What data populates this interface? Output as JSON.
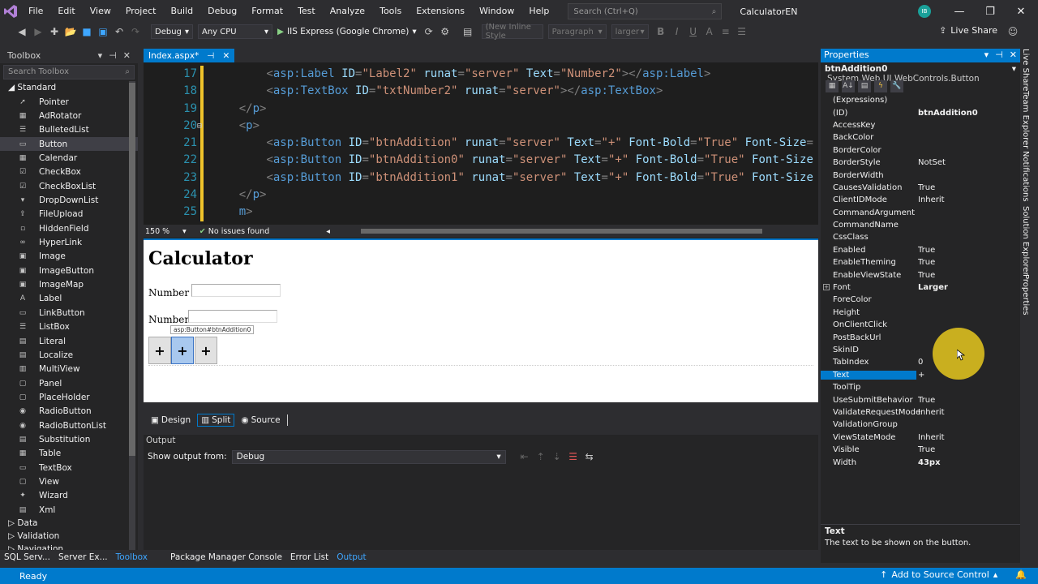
{
  "menu": [
    "File",
    "Edit",
    "View",
    "Project",
    "Build",
    "Debug",
    "Format",
    "Test",
    "Analyze",
    "Tools",
    "Extensions",
    "Window",
    "Help"
  ],
  "search": {
    "placeholder": "Search (Ctrl+Q)"
  },
  "solution_name": "CalculatorEN",
  "user_initials": "IB",
  "toolbar": {
    "config": "Debug",
    "platform": "Any CPU",
    "run_target": "IIS Express (Google Chrome)",
    "style_combo": "(New Inline Style",
    "block_combo": "Paragraph",
    "size_combo": "larger",
    "live_share": "Live Share"
  },
  "toolbox": {
    "title": "Toolbox",
    "search_placeholder": "Search Toolbox",
    "group_standard": "Standard",
    "items": [
      "Pointer",
      "AdRotator",
      "BulletedList",
      "Button",
      "Calendar",
      "CheckBox",
      "CheckBoxList",
      "DropDownList",
      "FileUpload",
      "HiddenField",
      "HyperLink",
      "Image",
      "ImageButton",
      "ImageMap",
      "Label",
      "LinkButton",
      "ListBox",
      "Literal",
      "Localize",
      "MultiView",
      "Panel",
      "PlaceHolder",
      "RadioButton",
      "RadioButtonList",
      "Substitution",
      "Table",
      "TextBox",
      "View",
      "Wizard",
      "Xml"
    ],
    "selected_item": "Button",
    "groups_collapsed": [
      "Data",
      "Validation",
      "Navigation"
    ]
  },
  "editor": {
    "tab_name": "Index.aspx*",
    "zoom": "150 %",
    "issues": "No issues found",
    "code_lines": [
      {
        "num": "17",
        "fold": "",
        "indent": "        ",
        "parts": [
          [
            "b",
            "<"
          ],
          [
            "t",
            "asp:Label"
          ],
          [
            "p",
            " "
          ],
          [
            "a",
            "ID"
          ],
          [
            "b",
            "="
          ],
          [
            "v",
            "\"Label2\""
          ],
          [
            "p",
            " "
          ],
          [
            "a",
            "runat"
          ],
          [
            "b",
            "="
          ],
          [
            "v",
            "\"server\""
          ],
          [
            "p",
            " "
          ],
          [
            "a",
            "Text"
          ],
          [
            "b",
            "="
          ],
          [
            "v",
            "\"Number2\""
          ],
          [
            "b",
            "></"
          ],
          [
            "t",
            "asp:Label"
          ],
          [
            "b",
            ">"
          ]
        ]
      },
      {
        "num": "18",
        "fold": "",
        "indent": "        ",
        "parts": [
          [
            "b",
            "<"
          ],
          [
            "t",
            "asp:TextBox"
          ],
          [
            "p",
            " "
          ],
          [
            "a",
            "ID"
          ],
          [
            "b",
            "="
          ],
          [
            "v",
            "\"txtNumber2\""
          ],
          [
            "p",
            " "
          ],
          [
            "a",
            "runat"
          ],
          [
            "b",
            "="
          ],
          [
            "v",
            "\"server\""
          ],
          [
            "b",
            "></"
          ],
          [
            "t",
            "asp:TextBox"
          ],
          [
            "b",
            ">"
          ]
        ]
      },
      {
        "num": "19",
        "fold": "",
        "indent": "    ",
        "parts": [
          [
            "b",
            "</"
          ],
          [
            "t",
            "p"
          ],
          [
            "b",
            ">"
          ]
        ]
      },
      {
        "num": "20",
        "fold": "⊟",
        "indent": "    ",
        "parts": [
          [
            "b",
            "<"
          ],
          [
            "t",
            "p"
          ],
          [
            "b",
            ">"
          ]
        ]
      },
      {
        "num": "21",
        "fold": "",
        "indent": "        ",
        "parts": [
          [
            "b",
            "<"
          ],
          [
            "t",
            "asp:Button"
          ],
          [
            "p",
            " "
          ],
          [
            "a",
            "ID"
          ],
          [
            "b",
            "="
          ],
          [
            "v",
            "\"btnAddition\""
          ],
          [
            "p",
            " "
          ],
          [
            "a",
            "runat"
          ],
          [
            "b",
            "="
          ],
          [
            "v",
            "\"server\""
          ],
          [
            "p",
            " "
          ],
          [
            "a",
            "Text"
          ],
          [
            "b",
            "="
          ],
          [
            "v",
            "\"+\""
          ],
          [
            "p",
            " "
          ],
          [
            "a",
            "Font-Bold"
          ],
          [
            "b",
            "="
          ],
          [
            "v",
            "\"True\""
          ],
          [
            "p",
            " "
          ],
          [
            "a",
            "Font-Size"
          ],
          [
            "b",
            "="
          ]
        ]
      },
      {
        "num": "22",
        "fold": "",
        "indent": "        ",
        "parts": [
          [
            "b",
            "<"
          ],
          [
            "t",
            "asp:Button"
          ],
          [
            "p",
            " "
          ],
          [
            "a",
            "ID"
          ],
          [
            "b",
            "="
          ],
          [
            "v",
            "\"btnAddition0\""
          ],
          [
            "p",
            " "
          ],
          [
            "a",
            "runat"
          ],
          [
            "b",
            "="
          ],
          [
            "v",
            "\"server\""
          ],
          [
            "p",
            " "
          ],
          [
            "a",
            "Text"
          ],
          [
            "b",
            "="
          ],
          [
            "v",
            "\"+\""
          ],
          [
            "p",
            " "
          ],
          [
            "a",
            "Font-Bold"
          ],
          [
            "b",
            "="
          ],
          [
            "v",
            "\"True\""
          ],
          [
            "p",
            " "
          ],
          [
            "a",
            "Font-Size"
          ]
        ]
      },
      {
        "num": "23",
        "fold": "",
        "indent": "        ",
        "parts": [
          [
            "b",
            "<"
          ],
          [
            "t",
            "asp:Button"
          ],
          [
            "p",
            " "
          ],
          [
            "a",
            "ID"
          ],
          [
            "b",
            "="
          ],
          [
            "v",
            "\"btnAddition1\""
          ],
          [
            "p",
            " "
          ],
          [
            "a",
            "runat"
          ],
          [
            "b",
            "="
          ],
          [
            "v",
            "\"server\""
          ],
          [
            "p",
            " "
          ],
          [
            "a",
            "Text"
          ],
          [
            "b",
            "="
          ],
          [
            "v",
            "\"+\""
          ],
          [
            "p",
            " "
          ],
          [
            "a",
            "Font-Bold"
          ],
          [
            "b",
            "="
          ],
          [
            "v",
            "\"True\""
          ],
          [
            "p",
            " "
          ],
          [
            "a",
            "Font-Size"
          ]
        ]
      },
      {
        "num": "24",
        "fold": "",
        "indent": "    ",
        "parts": [
          [
            "b",
            "</"
          ],
          [
            "t",
            "p"
          ],
          [
            "b",
            ">"
          ]
        ]
      },
      {
        "num": "25",
        "fold": "",
        "indent": "    ",
        "parts": [
          [
            "t",
            "m"
          ],
          [
            "b",
            ">"
          ]
        ]
      }
    ],
    "design": {
      "title": "Calculator",
      "label1": "Number 1",
      "label2": "Number2",
      "button_tag": "asp:Button#btnAddition0",
      "buttons": [
        "+",
        "+",
        "+"
      ]
    },
    "view_tabs": [
      "Design",
      "Split",
      "Source"
    ],
    "active_view": "Split"
  },
  "output": {
    "title": "Output",
    "show_from_label": "Show output from:",
    "show_from_value": "Debug"
  },
  "bottom_tabs": [
    "SQL Serv...",
    "Server Ex...",
    "Toolbox",
    "Package Manager Console",
    "Error List",
    "Output"
  ],
  "active_bottom_tabs": [
    "Toolbox",
    "Output"
  ],
  "status": {
    "left": "Ready",
    "source_control": "Add to Source Control"
  },
  "properties": {
    "title": "Properties",
    "object_name": "btnAddition0",
    "object_type": "System.Web.UI.WebControls.Button",
    "rows": [
      {
        "name": "(Expressions)",
        "value": "",
        "bold": false
      },
      {
        "name": "(ID)",
        "value": "btnAddition0",
        "bold": true
      },
      {
        "name": "AccessKey",
        "value": "",
        "bold": false
      },
      {
        "name": "BackColor",
        "value": "",
        "bold": false
      },
      {
        "name": "BorderColor",
        "value": "",
        "bold": false
      },
      {
        "name": "BorderStyle",
        "value": "NotSet",
        "bold": false
      },
      {
        "name": "BorderWidth",
        "value": "",
        "bold": false
      },
      {
        "name": "CausesValidation",
        "value": "True",
        "bold": false
      },
      {
        "name": "ClientIDMode",
        "value": "Inherit",
        "bold": false
      },
      {
        "name": "CommandArgument",
        "value": "",
        "bold": false
      },
      {
        "name": "CommandName",
        "value": "",
        "bold": false
      },
      {
        "name": "CssClass",
        "value": "",
        "bold": false
      },
      {
        "name": "Enabled",
        "value": "True",
        "bold": false
      },
      {
        "name": "EnableTheming",
        "value": "True",
        "bold": false
      },
      {
        "name": "EnableViewState",
        "value": "True",
        "bold": false
      },
      {
        "name": "Font",
        "value": "Larger",
        "bold": true,
        "expandable": true
      },
      {
        "name": "ForeColor",
        "value": "",
        "bold": false
      },
      {
        "name": "Height",
        "value": "",
        "bold": false
      },
      {
        "name": "OnClientClick",
        "value": "",
        "bold": false
      },
      {
        "name": "PostBackUrl",
        "value": "",
        "bold": false
      },
      {
        "name": "SkinID",
        "value": "",
        "bold": false
      },
      {
        "name": "TabIndex",
        "value": "0",
        "bold": false
      },
      {
        "name": "Text",
        "value": "+",
        "bold": false,
        "selected": true
      },
      {
        "name": "ToolTip",
        "value": "",
        "bold": false
      },
      {
        "name": "UseSubmitBehavior",
        "value": "True",
        "bold": false
      },
      {
        "name": "ValidateRequestMode",
        "value": "Inherit",
        "bold": false
      },
      {
        "name": "ValidationGroup",
        "value": "",
        "bold": false
      },
      {
        "name": "ViewStateMode",
        "value": "Inherit",
        "bold": false
      },
      {
        "name": "Visible",
        "value": "True",
        "bold": false
      },
      {
        "name": "Width",
        "value": "43px",
        "bold": true
      }
    ],
    "desc_title": "Text",
    "desc_text": "The text to be shown on the button."
  },
  "side_tabs": [
    "Live Share",
    "Team Explorer",
    "Notifications",
    "Solution Explorer",
    "Properties"
  ],
  "colors": {
    "accent": "#007acc",
    "cursor_highlight": "#e6c81e"
  }
}
